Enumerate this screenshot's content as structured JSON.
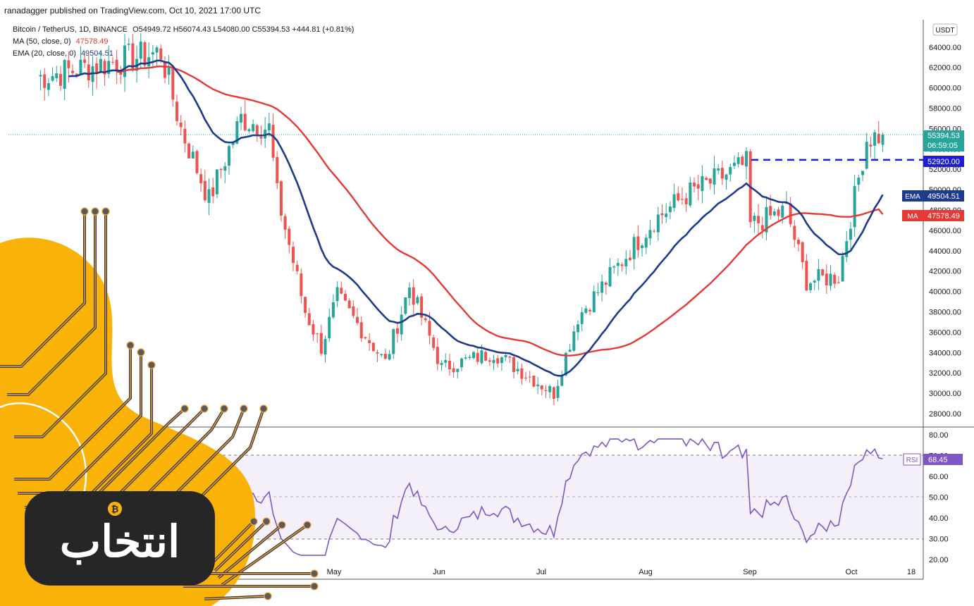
{
  "header": {
    "published": "ranadagger published on TradingView.com, Oct 10, 2021 17:00 UTC",
    "symbol": "Bitcoin / TetherUS, 1D, BINANCE",
    "ohlc": "O54949.72  H56074.43  L54080.00  C55394.53  +444.81 (+0.81%)",
    "ma_label": "MA (50, close, 0)",
    "ma_value": "47578.49",
    "ema_label": "EMA (20, close, 0)",
    "ema_value": "49504.51"
  },
  "currency_badge": "USDT",
  "colors": {
    "up": "#26a69a",
    "down": "#ef5350",
    "ma": "#e53935",
    "ema": "#1e3a8a",
    "level": "#1d1dd8",
    "rsi": "#7e57c2",
    "logo_orange": "#f9b208",
    "logo_dark": "#262626"
  },
  "price_axis": {
    "ticks": [
      "64000.00",
      "62000.00",
      "60000.00",
      "58000.00",
      "56000.00",
      "54000.00",
      "52000.00",
      "50000.00",
      "48000.00",
      "46000.00",
      "44000.00",
      "42000.00",
      "40000.00",
      "38000.00",
      "36000.00",
      "34000.00",
      "32000.00",
      "30000.00",
      "28000.00"
    ],
    "top_partial": "6",
    "current_price": "55394.53",
    "countdown": "06:59:05",
    "level_label": "52920.00",
    "ema_tag": "EMA",
    "ema_tag_value": "49504.51",
    "ma_tag": "MA",
    "ma_tag_value": "47578.49"
  },
  "rsi_axis": {
    "ticks": [
      "80.00",
      "70.00",
      "60.00",
      "50.00",
      "40.00",
      "30.00",
      "20.00"
    ],
    "tag": "RSI",
    "value": "68.45"
  },
  "time_axis": [
    "May",
    "Jun",
    "Jul",
    "Aug",
    "Sep",
    "Oct",
    "18"
  ],
  "logo": {
    "symbol": "₿",
    "text": "انتخاب"
  },
  "chart_data": {
    "type": "candlestick",
    "title": "Bitcoin / TetherUS, 1D, BINANCE",
    "xlabel": "",
    "ylabel": "",
    "ylim": [
      27000,
      65500
    ],
    "x_range": [
      "2021-03-06",
      "2021-10-18"
    ],
    "horizontal_level": 52920,
    "anchors": [
      {
        "date": "2021-03-13",
        "close": 61000
      },
      {
        "date": "2021-04-13",
        "close": 63500
      },
      {
        "date": "2021-04-18",
        "close": 56000
      },
      {
        "date": "2021-04-25",
        "close": 49000
      },
      {
        "date": "2021-05-03",
        "close": 57000
      },
      {
        "date": "2021-05-10",
        "close": 56000
      },
      {
        "date": "2021-05-12",
        "close": 49500
      },
      {
        "date": "2021-05-19",
        "close": 38000
      },
      {
        "date": "2021-05-23",
        "close": 34500
      },
      {
        "date": "2021-05-27",
        "close": 39500
      },
      {
        "date": "2021-06-08",
        "close": 33000
      },
      {
        "date": "2021-06-14",
        "close": 40500
      },
      {
        "date": "2021-06-22",
        "close": 32500
      },
      {
        "date": "2021-07-05",
        "close": 34000
      },
      {
        "date": "2021-07-20",
        "close": 30000
      },
      {
        "date": "2021-07-26",
        "close": 37500
      },
      {
        "date": "2021-08-07",
        "close": 43500
      },
      {
        "date": "2021-08-14",
        "close": 47000
      },
      {
        "date": "2021-08-22",
        "close": 49500
      },
      {
        "date": "2021-09-06",
        "close": 52500
      },
      {
        "date": "2021-09-07",
        "close": 46500
      },
      {
        "date": "2021-09-16",
        "close": 48000
      },
      {
        "date": "2021-09-21",
        "close": 41000
      },
      {
        "date": "2021-09-29",
        "close": 41500
      },
      {
        "date": "2021-10-06",
        "close": 55000
      },
      {
        "date": "2021-10-10",
        "close": 55394.53
      }
    ],
    "series": [
      {
        "name": "MA (50, close, 0)",
        "last": 47578.49
      },
      {
        "name": "EMA (20, close, 0)",
        "last": 49504.51
      },
      {
        "name": "RSI",
        "last": 68.45,
        "ylim": [
          20,
          80
        ],
        "band": [
          30,
          70
        ]
      }
    ]
  }
}
